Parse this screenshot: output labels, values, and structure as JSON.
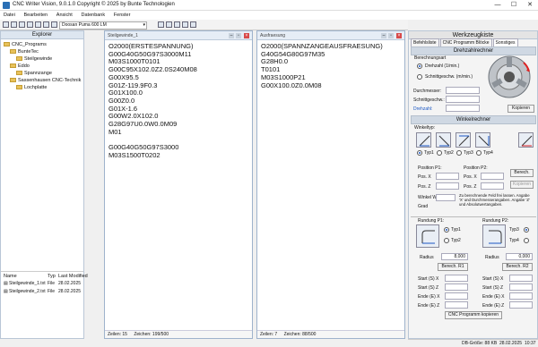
{
  "window": {
    "title": "CNC Writer Vision, 9.0.1.0 Copyright © 2025 by Bunte Technologien",
    "controls": [
      "—",
      "☐",
      "✕"
    ]
  },
  "menu": [
    "Datei",
    "Bearbeiten",
    "Ansicht",
    "Datenbank",
    "Fenster"
  ],
  "toolbar": {
    "machine": "Doosan Puma 600 LM"
  },
  "explorer": {
    "title": "Explorer",
    "tree": [
      {
        "label": "CNC_Programs",
        "level": 0
      },
      {
        "label": "BunteTec",
        "level": 1
      },
      {
        "label": "Steilgewinde",
        "level": 2
      },
      {
        "label": "Eddo",
        "level": 1
      },
      {
        "label": "Spannzange",
        "level": 2
      },
      {
        "label": "Sassenhausen CNC-Technik",
        "level": 1
      },
      {
        "label": "Lochplatte",
        "level": 2
      }
    ],
    "files_header": {
      "name": "Name",
      "type": "Typ",
      "modified": "Last Modified"
    },
    "files": [
      {
        "name": "Steilgewinde_1.txt",
        "type": "File",
        "modified": "28.02.2025"
      },
      {
        "name": "Steilgewinde_2.txt",
        "type": "File",
        "modified": "28.02.2025"
      }
    ]
  },
  "editor1": {
    "title": "Steilgewinde_1",
    "code": "O2000(ERSTESPANNUNG)\nG00G40G50G97S3000M11\nM03S1000T0101\nG00C95X102.0Z2.0S240M08\nG00X95.5\nG01Z-119.9F0.3\nG01X100.0\nG00Z0.0\nG01X-1.6\nG00W2.0X102.0\nG28G97U0.0W0.0M09\nM01\n\nG00G40G50G97S3000\nM03S1500T0202",
    "lines": "Zeilen: 15",
    "chars": "Zeichen: 199/500"
  },
  "editor2": {
    "title": "Ausfraesung",
    "code": "O2000(SPANNZANGEAUSFRAESUNG)\nG40G54G80G97M35\nG28H0.0\nT0101\nM03S1000P21\nG00X100.0Z0.0M08",
    "lines": "Zeilen: 7",
    "chars": "Zeichen: 88/500"
  },
  "tools": {
    "title": "Werkzeugkiste",
    "tabs": [
      "Befehlsliste",
      "CNC Programm Blöcke",
      "Sonstiges"
    ],
    "drehzahl": {
      "head": "Drehzahlrechner",
      "group": "Berechnungsart",
      "opt1": "Drehzahl (1/min.)",
      "opt2": "Schnittgeschw. (m/min.)",
      "durchmesser": "Durchmesser:",
      "schnitt": "Schnittgeschw.:",
      "drehzahl": "Drehzahl:",
      "copy": "Kopieren"
    },
    "winkel": {
      "head": "Winkelrechner",
      "typ_label": "Winkeltyp:",
      "types": [
        "Typ1",
        "Typ2",
        "Typ3",
        "Typ4"
      ],
      "p1": "Position P1:",
      "p2": "Position P2:",
      "posx": "Pos. X",
      "posz": "Pos. Z",
      "calc": "Berech.",
      "copy": "Kopieren",
      "winkelw": "Winkel W:",
      "grad": "Grad",
      "hint": "Zu berechnende Feld frei lassen. Angabe 'X' und Durchmesserangaben. Angabe 'Z' und Absolutwertangaben."
    },
    "rundung": {
      "p1": "Rundung P1:",
      "p2": "Rundung P2:",
      "typ1": "Typ1",
      "typ2": "Typ2",
      "typ3": "Typ3",
      "typ4": "Typ4",
      "radius": "Radius",
      "r1": "8,000",
      "r2": "0,000",
      "calc1": "Berech. R1",
      "calc2": "Berech. R2",
      "startx": "Start (S) X",
      "startz": "Start (S) Z",
      "endex": "Ende (E) X",
      "endez": "Ende (E) Z",
      "copy_prog": "CNC Programm kopieren"
    }
  },
  "status": {
    "db": "DB-Größe: 88 KB",
    "date": "28.02.2025",
    "time": "10:37"
  }
}
